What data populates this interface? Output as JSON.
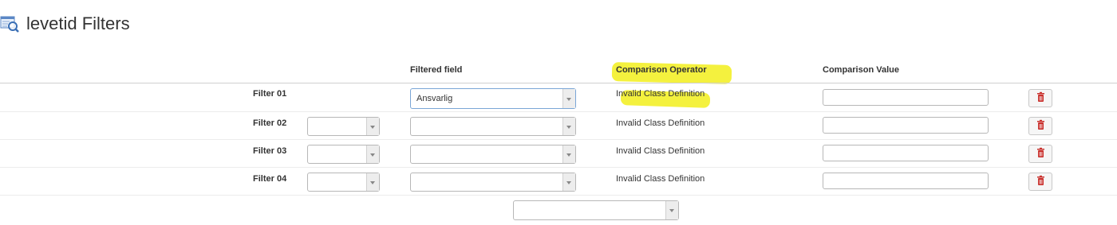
{
  "header": {
    "title": "levetid Filters",
    "icon": "table-search-icon"
  },
  "columns": {
    "filtered_field": "Filtered field",
    "comparison_operator": "Comparison Operator",
    "comparison_value": "Comparison Value"
  },
  "filters": [
    {
      "label": "Filter 01",
      "field_value": "Ansvarlig",
      "operator": "Invalid Class Definition"
    },
    {
      "label": "Filter 02",
      "field_value": "",
      "operator": "Invalid Class Definition"
    },
    {
      "label": "Filter 03",
      "field_value": "",
      "operator": "Invalid Class Definition"
    },
    {
      "label": "Filter 04",
      "field_value": "",
      "operator": "Invalid Class Definition"
    }
  ],
  "footer": {
    "add_field_value": ""
  },
  "colors": {
    "highlight": "#f2ef1c",
    "delete_icon": "#c9302c",
    "focus_border": "#7aa6d6"
  }
}
